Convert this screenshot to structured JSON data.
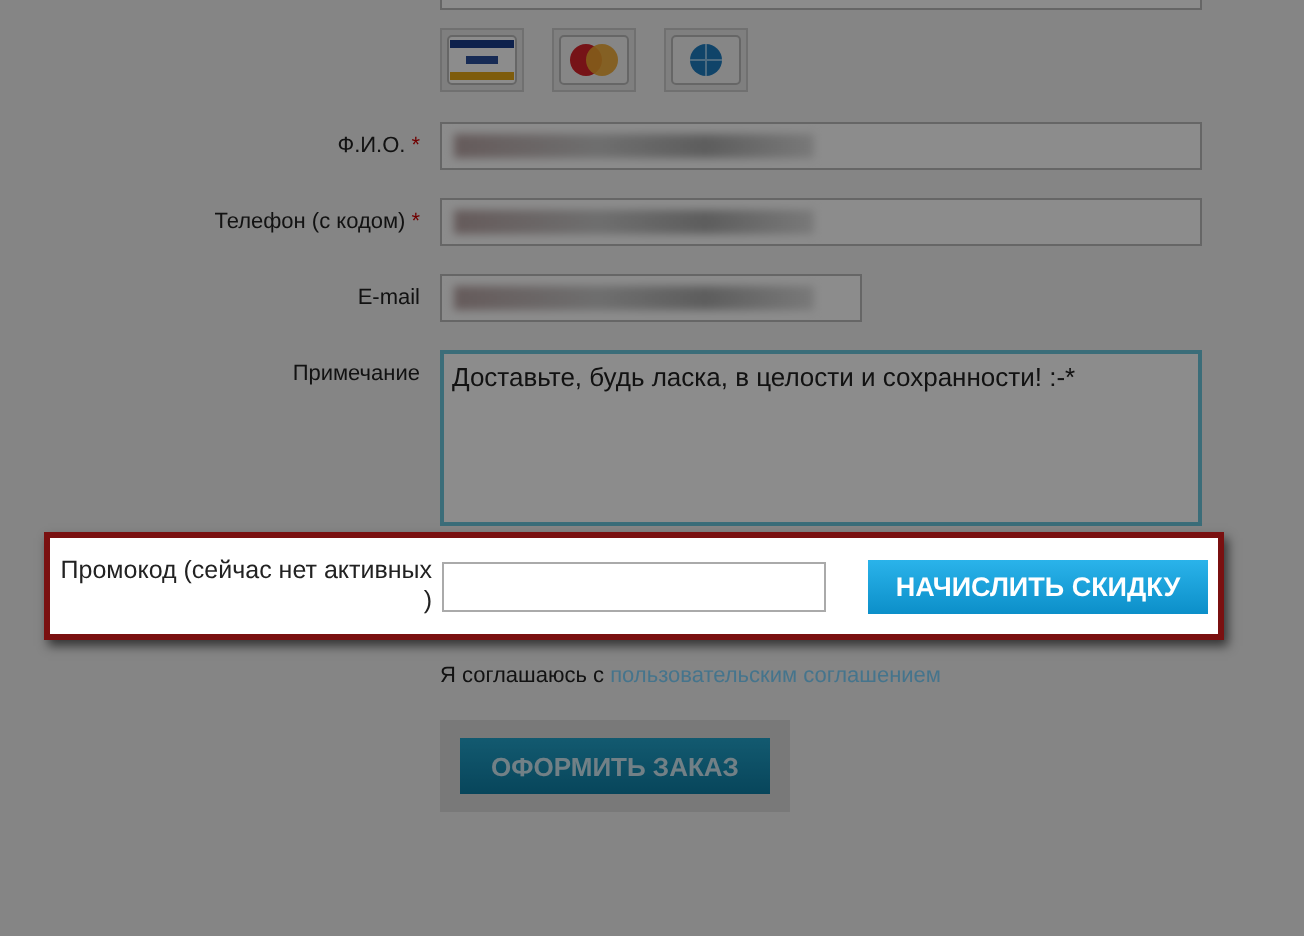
{
  "form": {
    "top_field": {
      "kind": "input"
    },
    "payment_methods": [
      {
        "kind": "visa"
      },
      {
        "kind": "mastercard"
      },
      {
        "kind": "globe"
      }
    ],
    "fields": [
      {
        "label": "Ф.И.О.",
        "required_mark": "*",
        "kind": "input",
        "filled": true
      },
      {
        "label": "Телефон (с кодом)",
        "required_mark": "*",
        "kind": "input",
        "filled": true
      },
      {
        "label": "E-mail",
        "kind": "short_input",
        "filled": true
      },
      {
        "label": "Примечание",
        "kind": "textarea",
        "value": "Доставьте, будь ласка, в целости и сохранности! :-*",
        "focused": true
      }
    ],
    "promo": {
      "label": "Промокод (сейчас нет активных )",
      "button": "НАЧИСЛИТЬ СКИДКУ",
      "highlighted": true
    },
    "agreement": {
      "text": "Я соглашаюсь с",
      "link": "пользовательским соглашением"
    },
    "submit": "ОФОРМИТЬ ЗАКАЗ"
  }
}
